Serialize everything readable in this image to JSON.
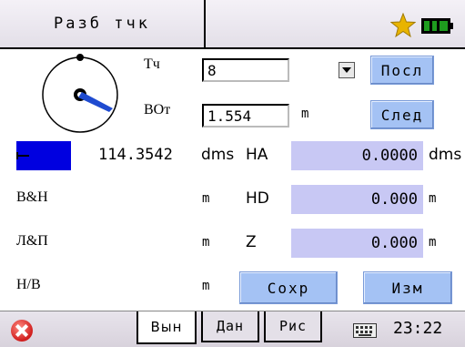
{
  "header": {
    "title": "Разб тчк"
  },
  "form": {
    "point_label": "Тч",
    "point_value": "8",
    "height_label": "ВОт",
    "height_value": "1.554",
    "height_unit": "m",
    "prev_button": "Посл",
    "next_button": "След"
  },
  "readings": {
    "angle_value": "114.3542",
    "angle_unit": "dms",
    "ha_label": "HA",
    "ha_value": "0.0000",
    "ha_unit": "dms",
    "bh_label": "В&Н",
    "bh_unit": "m",
    "hd_label": "HD",
    "hd_value": "0.000",
    "hd_unit": "m",
    "lp_label": "Л&П",
    "lp_unit": "m",
    "z_label": "Z",
    "z_value": "0.000",
    "z_unit": "m",
    "hv_label": "Н/В",
    "hv_unit": "m",
    "save_button": "Сохр",
    "change_button": "Изм"
  },
  "tabs": [
    {
      "label": "Вын",
      "active": true
    },
    {
      "label": "Дан",
      "active": false
    },
    {
      "label": "Рис",
      "active": false
    }
  ],
  "statusbar": {
    "time": "23:22"
  },
  "colors": {
    "accent_button": "#a4c2f4",
    "value_box": "#c8c8f4",
    "marker": "#0000e0"
  }
}
